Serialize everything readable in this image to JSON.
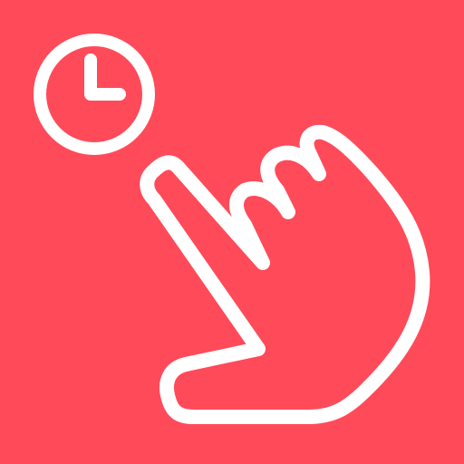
{
  "icon": {
    "name": "long-press-gesture-icon",
    "background_color": "#FF4A5A",
    "stroke_color": "#FFFFFF",
    "parts": [
      "clock-icon",
      "pointing-hand-icon"
    ]
  }
}
